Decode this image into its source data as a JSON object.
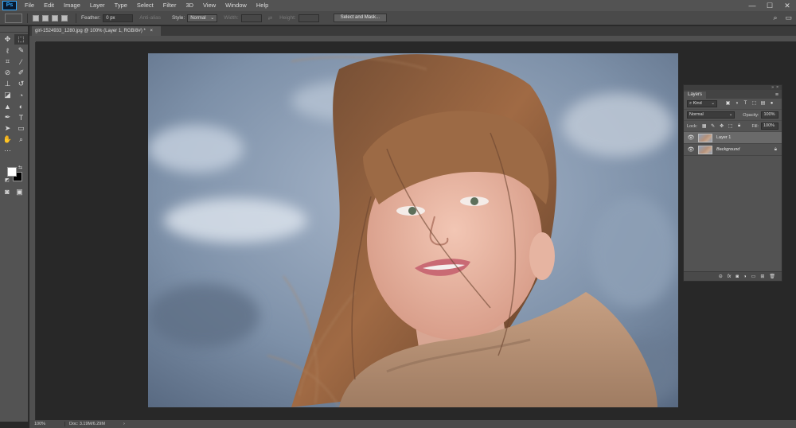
{
  "app": {
    "logo": "Ps"
  },
  "menu": [
    "File",
    "Edit",
    "Image",
    "Layer",
    "Type",
    "Select",
    "Filter",
    "3D",
    "View",
    "Window",
    "Help"
  ],
  "window_controls": {
    "minimize": "—",
    "maximize": "☐",
    "close": "✕"
  },
  "options_bar": {
    "feather_label": "Feather:",
    "feather_value": "0 px",
    "antialias_label": "Anti-alias",
    "style_label": "Style:",
    "style_value": "Normal",
    "width_label": "Width:",
    "height_label": "Height:",
    "select_mask_button": "Select and Mask..."
  },
  "document": {
    "tab_title": "girl-1524933_1280.jpg @ 100% (Layer 1, RGB/8#) *"
  },
  "status": {
    "zoom": "100%",
    "doc_size": "Doc: 3.19M/6.29M"
  },
  "layers_panel": {
    "tab": "Layers",
    "kind_filter": "Kind",
    "blend_mode": "Normal",
    "opacity_label": "Opacity:",
    "opacity_value": "100%",
    "lock_label": "Lock:",
    "fill_label": "Fill:",
    "fill_value": "100%",
    "layers": [
      {
        "name": "Layer 1",
        "visible": true,
        "selected": true,
        "locked": false
      },
      {
        "name": "Background",
        "visible": true,
        "selected": false,
        "locked": true
      }
    ]
  },
  "colors": {
    "foreground": "#ffffff",
    "background": "#000000",
    "accent": "#31a8ff"
  }
}
